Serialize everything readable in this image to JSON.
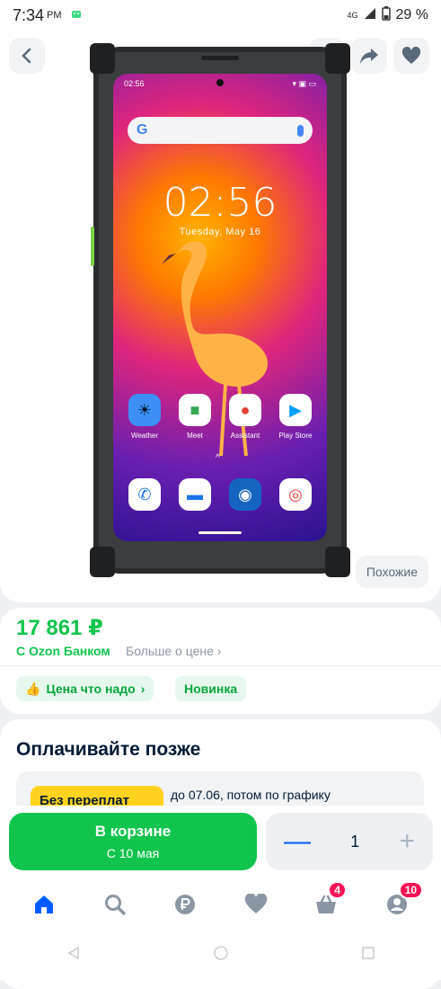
{
  "status_bar": {
    "time": "7:34",
    "ampm": "PM",
    "network": "4G",
    "battery": "29 %"
  },
  "gallery": {
    "similar_label": "Похожие",
    "phone_screen": {
      "status_time": "02:56",
      "clock": "02:56",
      "date": "Tuesday, May 16",
      "dock_apps": [
        "Weather",
        "Meet",
        "Assistant",
        "Play Store"
      ]
    }
  },
  "product": {
    "price": "17 861 ₽",
    "bank_label": "С Ozon Банком",
    "more_price_label": "Больше о цене",
    "chips": [
      "Цена что надо",
      "Новинка"
    ]
  },
  "pay_later": {
    "title": "Оплачивайте позже",
    "badge": "Без переплат",
    "text": "до 07.06, потом по графику"
  },
  "buy_bar": {
    "cart_label": "В корзине",
    "delivery_label": "С 10 мая",
    "quantity": "1"
  },
  "tab_bar": {
    "cart_count": "4",
    "profile_count": "10"
  },
  "colors": {
    "accent_green": "#10c44c",
    "brand_blue": "#005bff",
    "badge_pink": "#f91155"
  }
}
